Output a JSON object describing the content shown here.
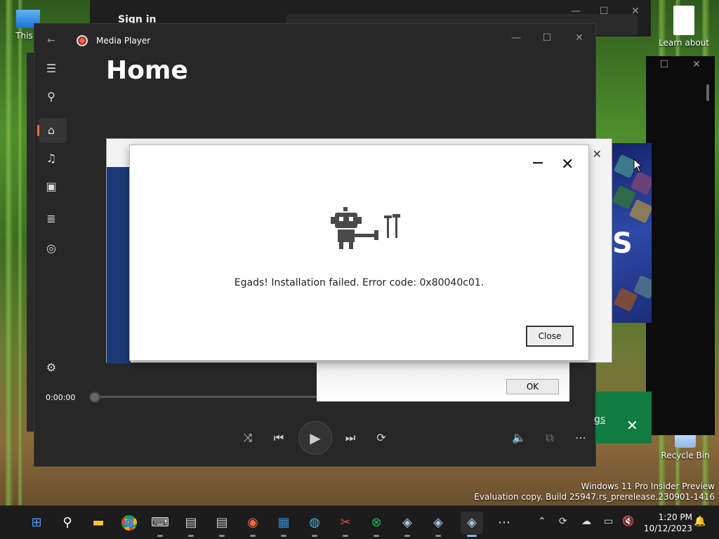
{
  "desktop": {
    "this_pc_label": "This P",
    "learn_about_label": "Learn about",
    "recycle_bin_label": "Recycle Bin"
  },
  "watermark": {
    "line1": "Windows 11 Pro Insider Preview",
    "line2": "Evaluation copy. Build 25947.rs_prerelease.230901-1416"
  },
  "signin_window": {
    "title": "Sign in"
  },
  "media_player": {
    "app_title": "Media Player",
    "page_title": "Home",
    "time_elapsed": "0:00:00",
    "progress": 0,
    "nav": [
      "menu-icon",
      "search-icon",
      "home-icon",
      "music-icon",
      "video-icon",
      "playlist-icon",
      "disc-icon",
      "gear-icon"
    ]
  },
  "store_banner": {
    "letter": "S"
  },
  "ok_dialog": {
    "ok_label": "OK"
  },
  "error_dialog": {
    "message": "Egads! Installation failed. Error code: 0x80040c01.",
    "close_label": "Close"
  },
  "green_banner": {
    "link_text": "gs"
  },
  "taskbar": {
    "apps": [
      "start-icon",
      "search-icon",
      "file-explorer-icon",
      "chrome-icon",
      "terminal-icon",
      "notepad-icon",
      "notepad-icon",
      "media-player-icon",
      "notes-icon",
      "globe-icon",
      "snipping-tool-icon",
      "xbox-icon",
      "installer-icon",
      "installer-icon",
      "installer-icon",
      "more-icon"
    ],
    "clock_time": "1:20 PM",
    "clock_date": "10/12/2023"
  },
  "colors": {
    "accent": "#f06a3e",
    "store_blue": "#1c3a78",
    "xbox_green": "#107c41"
  }
}
